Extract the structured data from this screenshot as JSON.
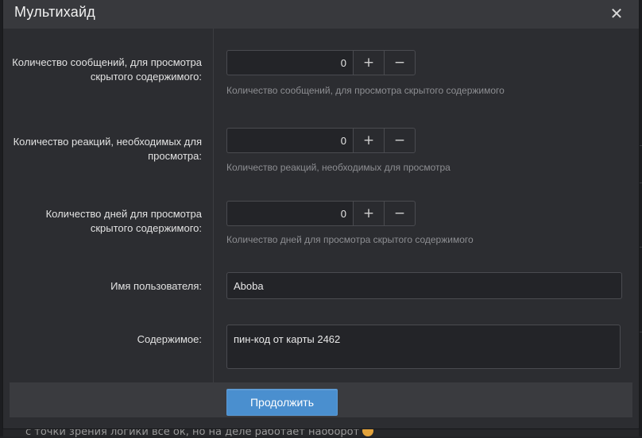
{
  "dialog": {
    "title": "Мультихайд",
    "close_glyph": "✕"
  },
  "fields": {
    "messages": {
      "label": "Количество сообщений, для просмотра скрытого содержимого:",
      "value": "0",
      "hint": "Количество сообщений, для просмотра скрытого содержимого",
      "plus": "+",
      "minus": "−"
    },
    "reactions": {
      "label": "Количество реакций, необходимых для просмотра:",
      "value": "0",
      "hint": "Количество реакций, необходимых для просмотра",
      "plus": "+",
      "minus": "−"
    },
    "days": {
      "label": "Количество дней для просмотра скрытого содержимого:",
      "value": "0",
      "hint": "Количество дней для просмотра скрытого содержимого",
      "plus": "+",
      "minus": "−"
    },
    "username": {
      "label": "Имя пользователя:",
      "value": "Aboba"
    },
    "content": {
      "label": "Содержимое:",
      "value": "пин-код от карты 2462"
    }
  },
  "footer": {
    "submit_label": "Продолжить"
  },
  "background": {
    "partial_text": "с точки зрения логики всё ок, но на деле работает наоборот"
  },
  "colors": {
    "accent": "#4a8fcf",
    "modal_bg": "#2c2d31",
    "header_bg": "#38393d"
  }
}
